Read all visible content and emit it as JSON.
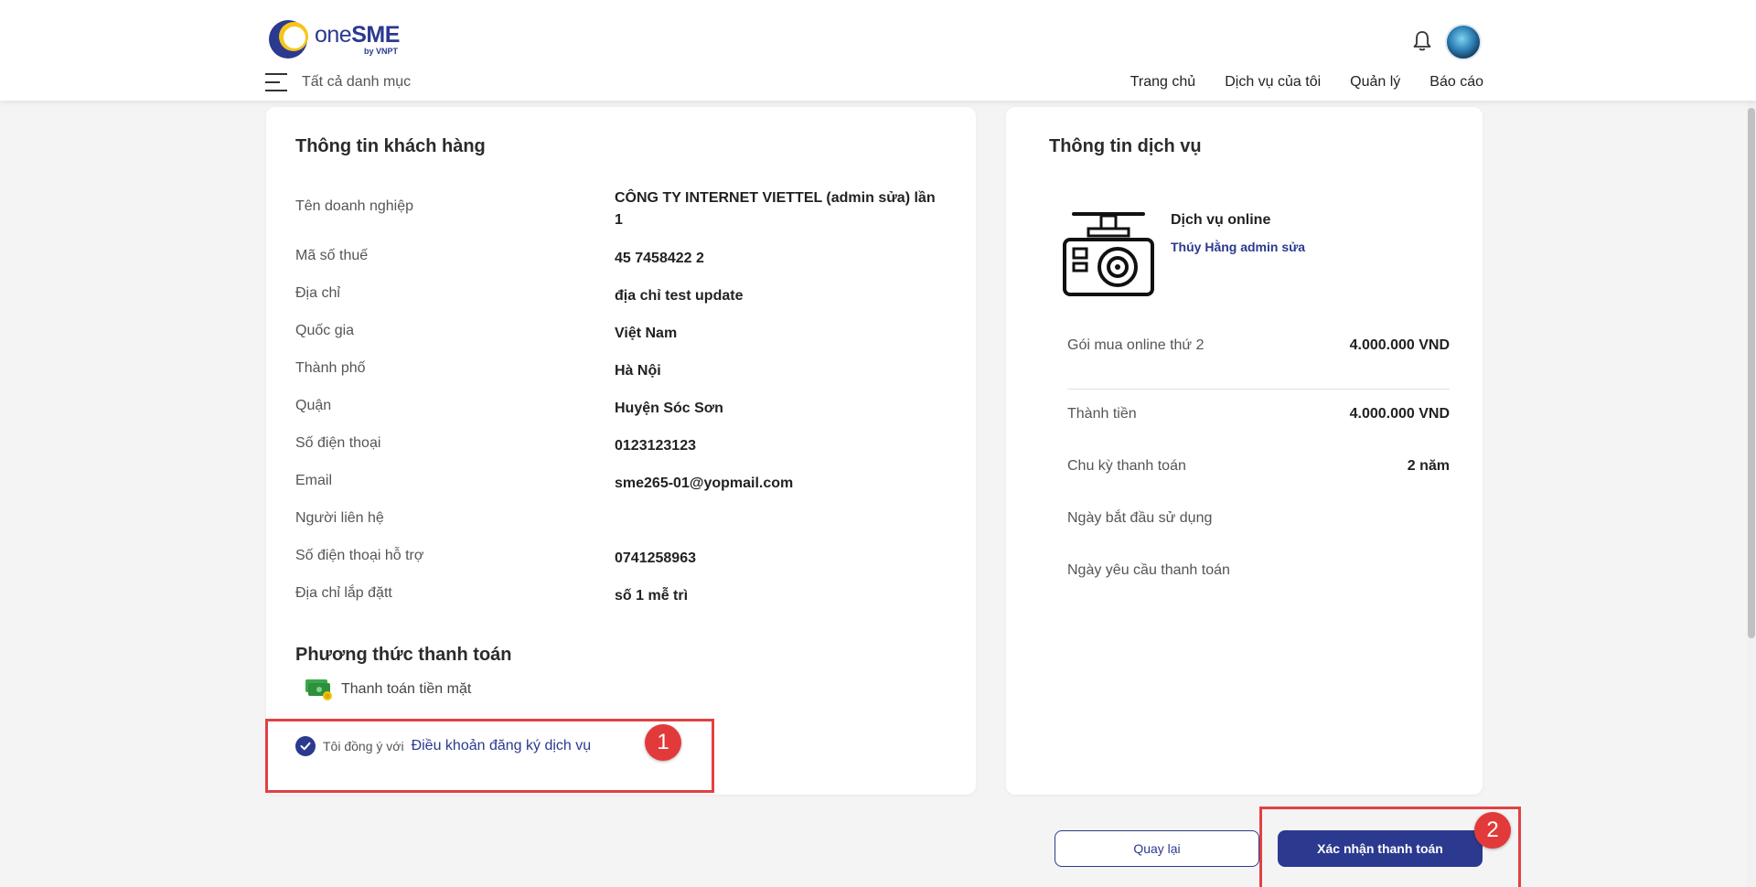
{
  "brand": {
    "name_one": "one",
    "name_sme": "SME",
    "sub": "by VNPT"
  },
  "header": {
    "all_categories": "Tất cả danh mục",
    "nav": [
      "Trang chủ",
      "Dịch vụ của tôi",
      "Quản lý",
      "Báo cáo"
    ]
  },
  "customer": {
    "title": "Thông tin khách hàng",
    "rows": [
      {
        "label": "Tên doanh nghiệp",
        "value": "CÔNG TY INTERNET VIETTEL (admin sửa) lần 1"
      },
      {
        "label": "Mã số thuế",
        "value": "45 7458422 2"
      },
      {
        "label": "Địa chỉ",
        "value": "địa chỉ test update"
      },
      {
        "label": "Quốc gia",
        "value": "Việt Nam"
      },
      {
        "label": "Thành phố",
        "value": "Hà Nội"
      },
      {
        "label": "Quận",
        "value": "Huyện Sóc Sơn"
      },
      {
        "label": "Số điện thoại",
        "value": "0123123123"
      },
      {
        "label": "Email",
        "value": "sme265-01@yopmail.com"
      },
      {
        "label": "Người liên hệ",
        "value": ""
      },
      {
        "label": "Số điện thoại hỗ trợ",
        "value": "0741258963"
      },
      {
        "label": "Địa chỉ lắp đặtt",
        "value": "số 1 mễ trì"
      }
    ]
  },
  "payment": {
    "title": "Phương thức thanh toán",
    "method": "Thanh toán tiền mặt",
    "agree_text": "Tôi đồng ý với",
    "agree_link": "Điều khoản đăng ký dịch vụ",
    "agreed": true
  },
  "service": {
    "title": "Thông tin dịch vụ",
    "name": "Dịch vụ online",
    "vendor": "Thúy Hằng admin sửa",
    "package_label": "Gói mua online thứ 2",
    "package_price": "4.000.000 VND",
    "rows": [
      {
        "label": "Thành tiền",
        "value": "4.000.000 VND"
      },
      {
        "label": "Chu kỳ thanh toán",
        "value": "2 năm"
      },
      {
        "label": "Ngày bắt đầu sử dụng",
        "value": ""
      },
      {
        "label": "Ngày yêu cầu thanh toán",
        "value": ""
      }
    ]
  },
  "actions": {
    "back": "Quay lại",
    "confirm": "Xác nhận thanh toán"
  },
  "annotations": {
    "badge1": "1",
    "badge2": "2"
  },
  "colors": {
    "primary": "#2b3a8f",
    "annotation": "#e04242"
  }
}
